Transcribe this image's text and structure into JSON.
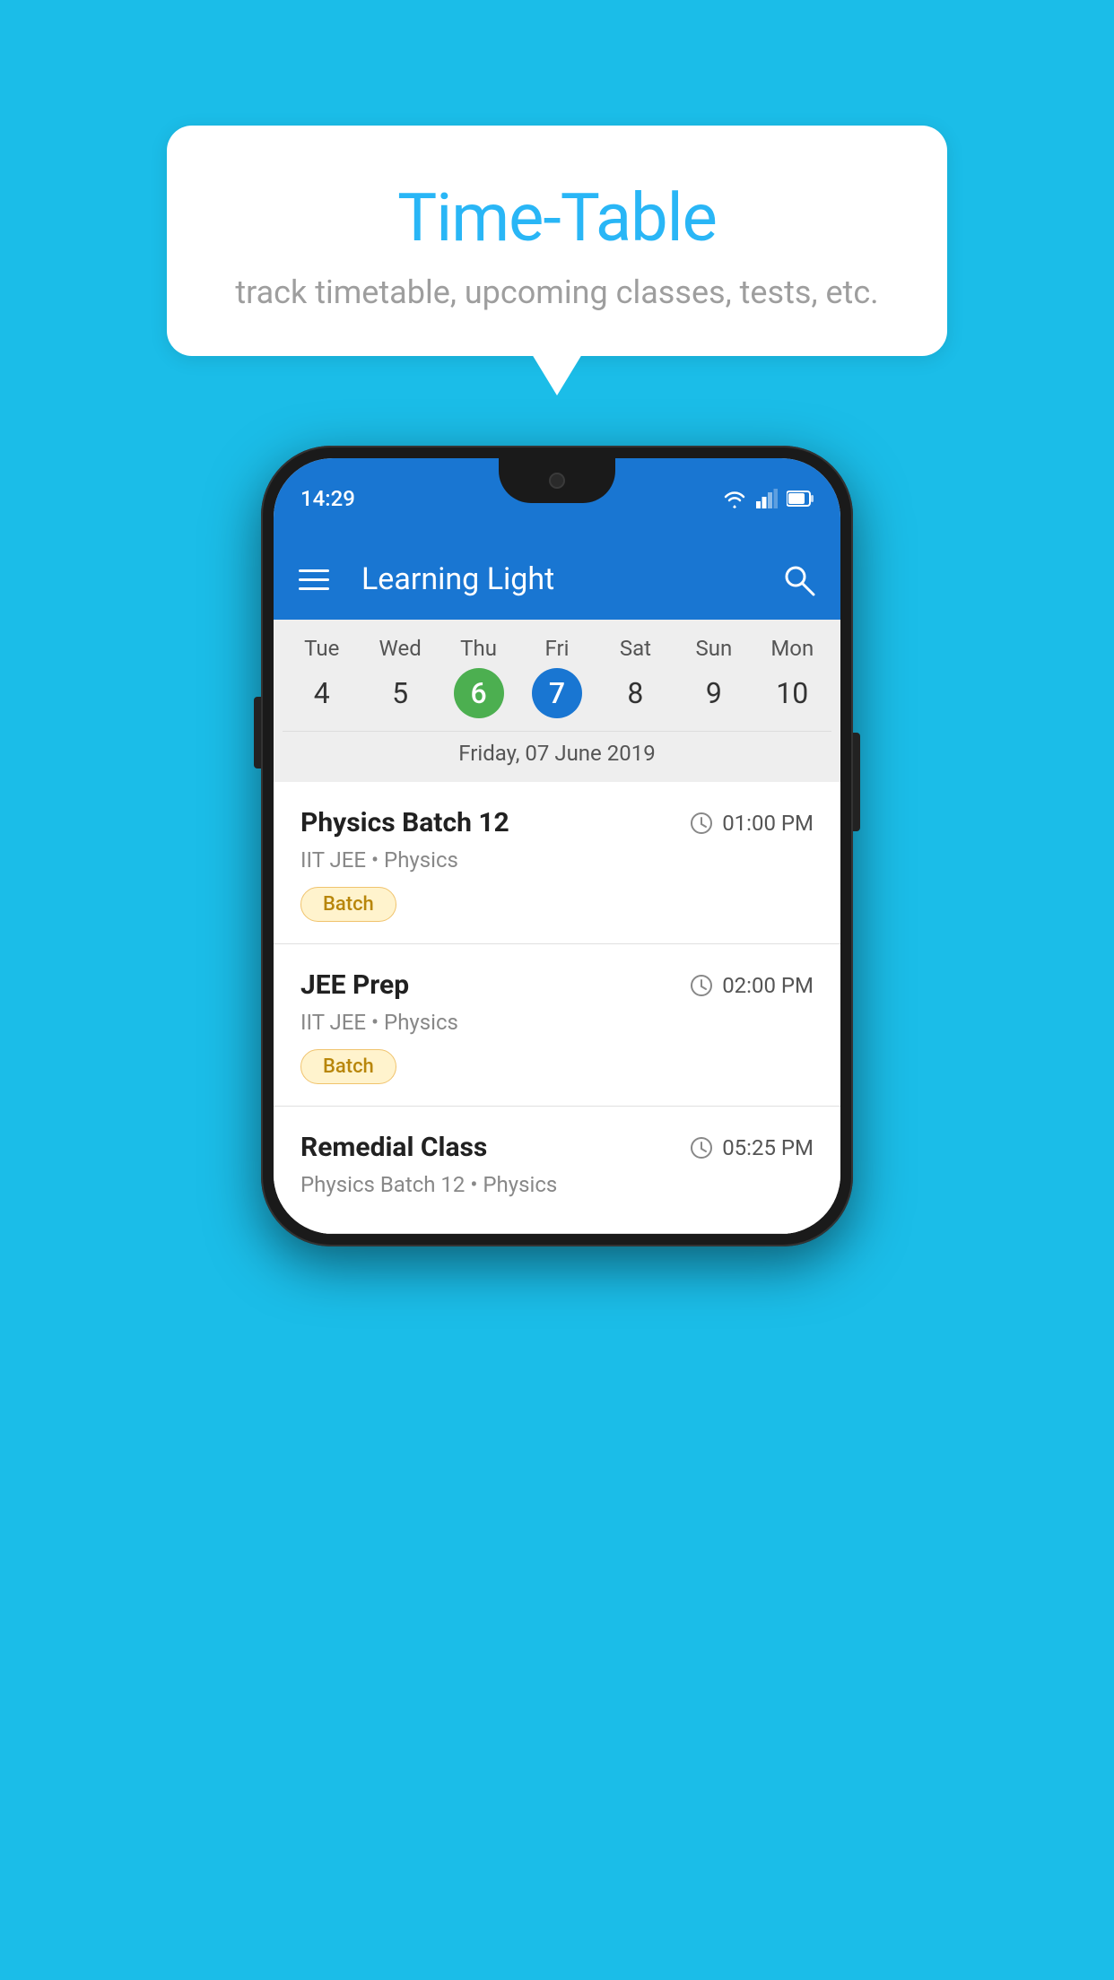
{
  "background_color": "#1bbde8",
  "tooltip": {
    "title": "Time-Table",
    "subtitle": "track timetable, upcoming classes, tests, etc."
  },
  "phone": {
    "status_bar": {
      "time": "14:29",
      "icons": [
        "wifi",
        "signal",
        "battery"
      ]
    },
    "app_bar": {
      "title": "Learning Light"
    },
    "calendar": {
      "days": [
        {
          "label": "Tue",
          "num": "4",
          "state": "normal"
        },
        {
          "label": "Wed",
          "num": "5",
          "state": "normal"
        },
        {
          "label": "Thu",
          "num": "6",
          "state": "today"
        },
        {
          "label": "Fri",
          "num": "7",
          "state": "selected"
        },
        {
          "label": "Sat",
          "num": "8",
          "state": "normal"
        },
        {
          "label": "Sun",
          "num": "9",
          "state": "normal"
        },
        {
          "label": "Mon",
          "num": "10",
          "state": "normal"
        }
      ],
      "selected_date_label": "Friday, 07 June 2019"
    },
    "schedule": [
      {
        "title": "Physics Batch 12",
        "time": "01:00 PM",
        "meta": "IIT JEE • Physics",
        "badge": "Batch"
      },
      {
        "title": "JEE Prep",
        "time": "02:00 PM",
        "meta": "IIT JEE • Physics",
        "badge": "Batch"
      },
      {
        "title": "Remedial Class",
        "time": "05:25 PM",
        "meta": "Physics Batch 12 • Physics",
        "badge": ""
      }
    ]
  }
}
